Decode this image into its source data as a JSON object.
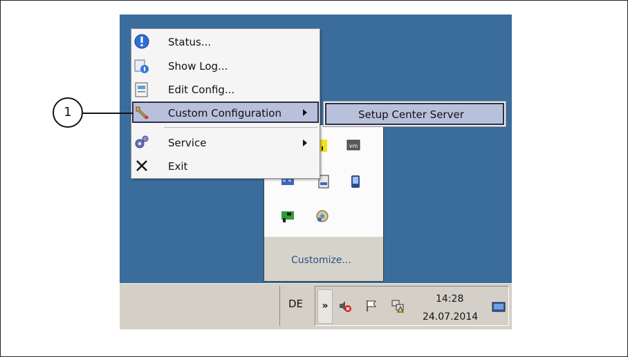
{
  "callout": {
    "number": "1"
  },
  "context_menu": {
    "items": [
      {
        "label": "Status...",
        "icon": "info-icon"
      },
      {
        "label": "Show Log...",
        "icon": "log-icon"
      },
      {
        "label": "Edit Config...",
        "icon": "config-icon"
      },
      {
        "label": "Custom Configuration",
        "icon": "wrench-icon",
        "has_submenu": true,
        "highlighted": true
      },
      {
        "label": "Service",
        "icon": "gears-icon",
        "has_submenu": true
      },
      {
        "label": "Exit",
        "icon": "close-icon"
      }
    ],
    "submenu": {
      "items": [
        {
          "label": "Setup Center Server",
          "highlighted": true
        }
      ]
    }
  },
  "tray_overflow": {
    "icons": [
      "yellow-app-icon",
      "vm-icon",
      "network-icon",
      "server-icon",
      "pda-icon",
      "network-card-icon",
      "cd-icon"
    ],
    "customize_label": "Customize..."
  },
  "taskbar": {
    "language": "DE",
    "show_hidden_icons": "»",
    "tray_icons": [
      "speaker-muted-icon",
      "flag-icon",
      "network-warning-icon",
      "show-desktop-icon"
    ],
    "time": "14:28",
    "date": "24.07.2014"
  },
  "colors": {
    "desktop": "#3b6d9c",
    "taskbar": "#d4d0c8",
    "menu_highlight": "#b9c0dc",
    "link": "#2b4f86"
  }
}
